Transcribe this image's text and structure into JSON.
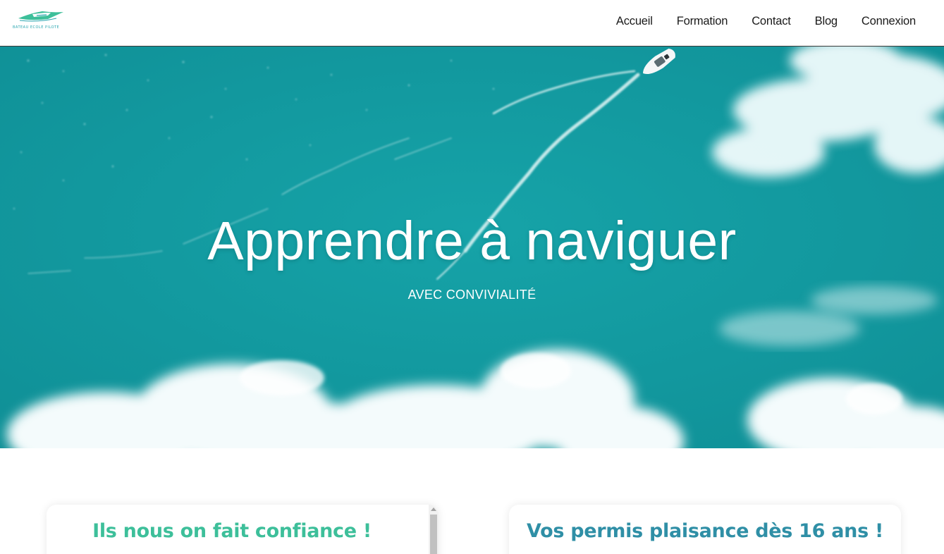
{
  "logo": {
    "text": "Bateau Ecole Pilote",
    "color": "#3dbf9a"
  },
  "nav": {
    "items": [
      {
        "label": "Accueil"
      },
      {
        "label": "Formation"
      },
      {
        "label": "Contact"
      },
      {
        "label": "Blog"
      },
      {
        "label": "Connexion"
      }
    ]
  },
  "hero": {
    "title": "Apprendre à naviguer",
    "subtitle": "AVEC CONVIVIALITÉ",
    "water_color": "#139a9f"
  },
  "cards": {
    "left_title": "Ils nous on fait confiance !",
    "right_title": "Vos permis plaisance dès 16 ans !",
    "left_color": "#3dbf9a",
    "right_color": "#2f8fa6"
  }
}
